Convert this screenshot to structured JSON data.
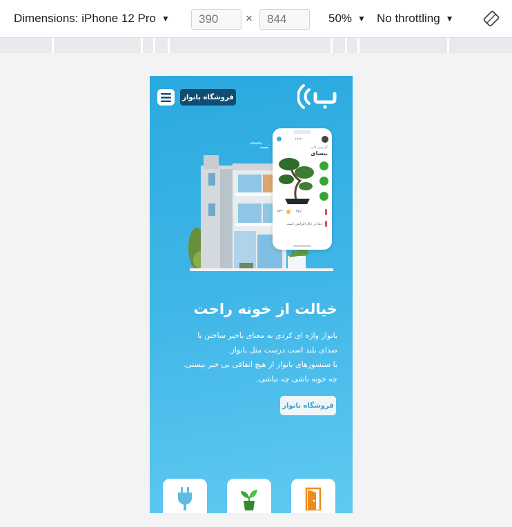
{
  "devtools": {
    "dimensions_label": "Dimensions: iPhone 12 Pro",
    "width_value": "390",
    "height_value": "844",
    "times": "×",
    "zoom": "50%",
    "throttling": "No throttling",
    "dropdown_caret": "▼"
  },
  "site": {
    "logo_letter": "ب",
    "shop_button_label": "فروشگاه بانواز",
    "headline": "خیالت از خونه راحت",
    "description_lines": [
      "بانواز واژه ای کردی به معنای باخبر ساختن با",
      "صدای بلند است.درست مثل بانواز.",
      "با سنسورهای بانواز از هیچ اتفاقی بی خبر نیستی.",
      "چه خونه باشی چه نباشی."
    ],
    "cta_label": "فروشگاه بانواز",
    "feature_cards": [
      {
        "icon": "plug-icon",
        "color": "#5fb9e3"
      },
      {
        "icon": "plant-icon",
        "color": "#3aa43a"
      },
      {
        "icon": "door-icon",
        "color": "#ef8b1c"
      }
    ]
  },
  "phone_mock": {
    "time": "۱۲:۳۰",
    "greeting": "گزارش کلی",
    "plant_name": "بنسای",
    "temp_value": "۲۴°",
    "humidity_value": "۴۵٪",
    "status_text": "دما در حال افزایش است"
  },
  "colors": {
    "brand_dark": "#0f4d73",
    "sky_top": "#2aa9df",
    "sky_bottom": "#5fcaf2",
    "accent_green": "#3aa43a",
    "accent_orange": "#ef8b1c"
  }
}
